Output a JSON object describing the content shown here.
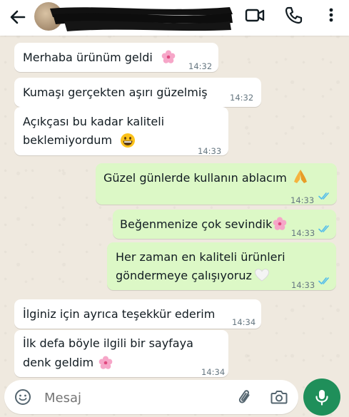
{
  "header": {
    "back_icon": "arrow-left-icon",
    "video_icon": "video-call-icon",
    "call_icon": "phone-icon",
    "menu_icon": "more-vertical-icon"
  },
  "messages": [
    {
      "dir": "in",
      "text": "Merhaba ürünüm geldi",
      "emoji": "cherry-blossom",
      "time": "14:32"
    },
    {
      "dir": "in",
      "text": "Kumaşı gerçekten aşırı güzelmiş",
      "time": "14:32"
    },
    {
      "dir": "in",
      "lines": [
        "Açıkçası bu kadar kaliteli",
        "beklemiyordum"
      ],
      "emoji": "grinning-face",
      "time": "14:33"
    },
    {
      "dir": "out",
      "text": "Güzel günlerde kullanın ablacım",
      "emoji": "folded-hands",
      "time": "14:33",
      "status": "read"
    },
    {
      "dir": "out",
      "text": "Beğenmenize çok sevindik",
      "emoji": "cherry-blossom",
      "time": "14:33",
      "status": "read"
    },
    {
      "dir": "out",
      "lines": [
        "Her zaman en kaliteli ürünleri",
        "göndermeye çalışıyoruz"
      ],
      "emoji": "white-heart",
      "time": "14:33",
      "status": "read"
    },
    {
      "dir": "in",
      "text": "İlginiz için ayrıca teşekkür ederim",
      "time": "14:34"
    },
    {
      "dir": "in",
      "lines": [
        "İlk defa böyle ilgili bir sayfaya",
        "denk geldim"
      ],
      "emoji": "cherry-blossom",
      "time": "14:34"
    }
  ],
  "composer": {
    "placeholder": "Mesaj",
    "emoji_icon": "emoji-icon",
    "attach_icon": "paperclip-icon",
    "camera_icon": "camera-icon",
    "mic_icon": "microphone-icon"
  },
  "colors": {
    "incoming": "#ffffff",
    "outgoing": "#dcf8c6",
    "read_ticks": "#53bdeb",
    "accent": "#1f8f5a"
  }
}
